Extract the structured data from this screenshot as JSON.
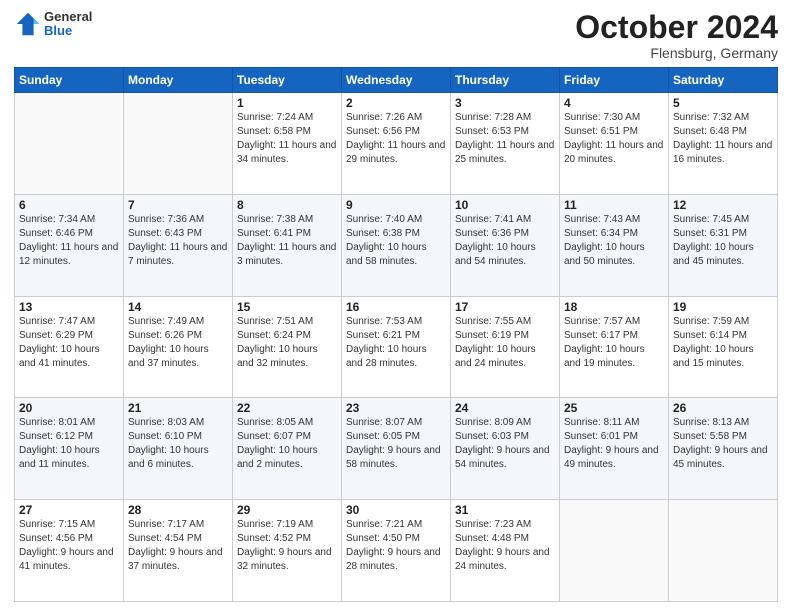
{
  "header": {
    "logo": {
      "general": "General",
      "blue": "Blue"
    },
    "month": "October 2024",
    "location": "Flensburg, Germany"
  },
  "weekdays": [
    "Sunday",
    "Monday",
    "Tuesday",
    "Wednesday",
    "Thursday",
    "Friday",
    "Saturday"
  ],
  "weeks": [
    [
      {
        "day": null
      },
      {
        "day": null
      },
      {
        "day": "1",
        "sunrise": "7:24 AM",
        "sunset": "6:58 PM",
        "daylight": "11 hours and 34 minutes."
      },
      {
        "day": "2",
        "sunrise": "7:26 AM",
        "sunset": "6:56 PM",
        "daylight": "11 hours and 29 minutes."
      },
      {
        "day": "3",
        "sunrise": "7:28 AM",
        "sunset": "6:53 PM",
        "daylight": "11 hours and 25 minutes."
      },
      {
        "day": "4",
        "sunrise": "7:30 AM",
        "sunset": "6:51 PM",
        "daylight": "11 hours and 20 minutes."
      },
      {
        "day": "5",
        "sunrise": "7:32 AM",
        "sunset": "6:48 PM",
        "daylight": "11 hours and 16 minutes."
      }
    ],
    [
      {
        "day": "6",
        "sunrise": "7:34 AM",
        "sunset": "6:46 PM",
        "daylight": "11 hours and 12 minutes."
      },
      {
        "day": "7",
        "sunrise": "7:36 AM",
        "sunset": "6:43 PM",
        "daylight": "11 hours and 7 minutes."
      },
      {
        "day": "8",
        "sunrise": "7:38 AM",
        "sunset": "6:41 PM",
        "daylight": "11 hours and 3 minutes."
      },
      {
        "day": "9",
        "sunrise": "7:40 AM",
        "sunset": "6:38 PM",
        "daylight": "10 hours and 58 minutes."
      },
      {
        "day": "10",
        "sunrise": "7:41 AM",
        "sunset": "6:36 PM",
        "daylight": "10 hours and 54 minutes."
      },
      {
        "day": "11",
        "sunrise": "7:43 AM",
        "sunset": "6:34 PM",
        "daylight": "10 hours and 50 minutes."
      },
      {
        "day": "12",
        "sunrise": "7:45 AM",
        "sunset": "6:31 PM",
        "daylight": "10 hours and 45 minutes."
      }
    ],
    [
      {
        "day": "13",
        "sunrise": "7:47 AM",
        "sunset": "6:29 PM",
        "daylight": "10 hours and 41 minutes."
      },
      {
        "day": "14",
        "sunrise": "7:49 AM",
        "sunset": "6:26 PM",
        "daylight": "10 hours and 37 minutes."
      },
      {
        "day": "15",
        "sunrise": "7:51 AM",
        "sunset": "6:24 PM",
        "daylight": "10 hours and 32 minutes."
      },
      {
        "day": "16",
        "sunrise": "7:53 AM",
        "sunset": "6:21 PM",
        "daylight": "10 hours and 28 minutes."
      },
      {
        "day": "17",
        "sunrise": "7:55 AM",
        "sunset": "6:19 PM",
        "daylight": "10 hours and 24 minutes."
      },
      {
        "day": "18",
        "sunrise": "7:57 AM",
        "sunset": "6:17 PM",
        "daylight": "10 hours and 19 minutes."
      },
      {
        "day": "19",
        "sunrise": "7:59 AM",
        "sunset": "6:14 PM",
        "daylight": "10 hours and 15 minutes."
      }
    ],
    [
      {
        "day": "20",
        "sunrise": "8:01 AM",
        "sunset": "6:12 PM",
        "daylight": "10 hours and 11 minutes."
      },
      {
        "day": "21",
        "sunrise": "8:03 AM",
        "sunset": "6:10 PM",
        "daylight": "10 hours and 6 minutes."
      },
      {
        "day": "22",
        "sunrise": "8:05 AM",
        "sunset": "6:07 PM",
        "daylight": "10 hours and 2 minutes."
      },
      {
        "day": "23",
        "sunrise": "8:07 AM",
        "sunset": "6:05 PM",
        "daylight": "9 hours and 58 minutes."
      },
      {
        "day": "24",
        "sunrise": "8:09 AM",
        "sunset": "6:03 PM",
        "daylight": "9 hours and 54 minutes."
      },
      {
        "day": "25",
        "sunrise": "8:11 AM",
        "sunset": "6:01 PM",
        "daylight": "9 hours and 49 minutes."
      },
      {
        "day": "26",
        "sunrise": "8:13 AM",
        "sunset": "5:58 PM",
        "daylight": "9 hours and 45 minutes."
      }
    ],
    [
      {
        "day": "27",
        "sunrise": "7:15 AM",
        "sunset": "4:56 PM",
        "daylight": "9 hours and 41 minutes."
      },
      {
        "day": "28",
        "sunrise": "7:17 AM",
        "sunset": "4:54 PM",
        "daylight": "9 hours and 37 minutes."
      },
      {
        "day": "29",
        "sunrise": "7:19 AM",
        "sunset": "4:52 PM",
        "daylight": "9 hours and 32 minutes."
      },
      {
        "day": "30",
        "sunrise": "7:21 AM",
        "sunset": "4:50 PM",
        "daylight": "9 hours and 28 minutes."
      },
      {
        "day": "31",
        "sunrise": "7:23 AM",
        "sunset": "4:48 PM",
        "daylight": "9 hours and 24 minutes."
      },
      {
        "day": null
      },
      {
        "day": null
      }
    ]
  ]
}
